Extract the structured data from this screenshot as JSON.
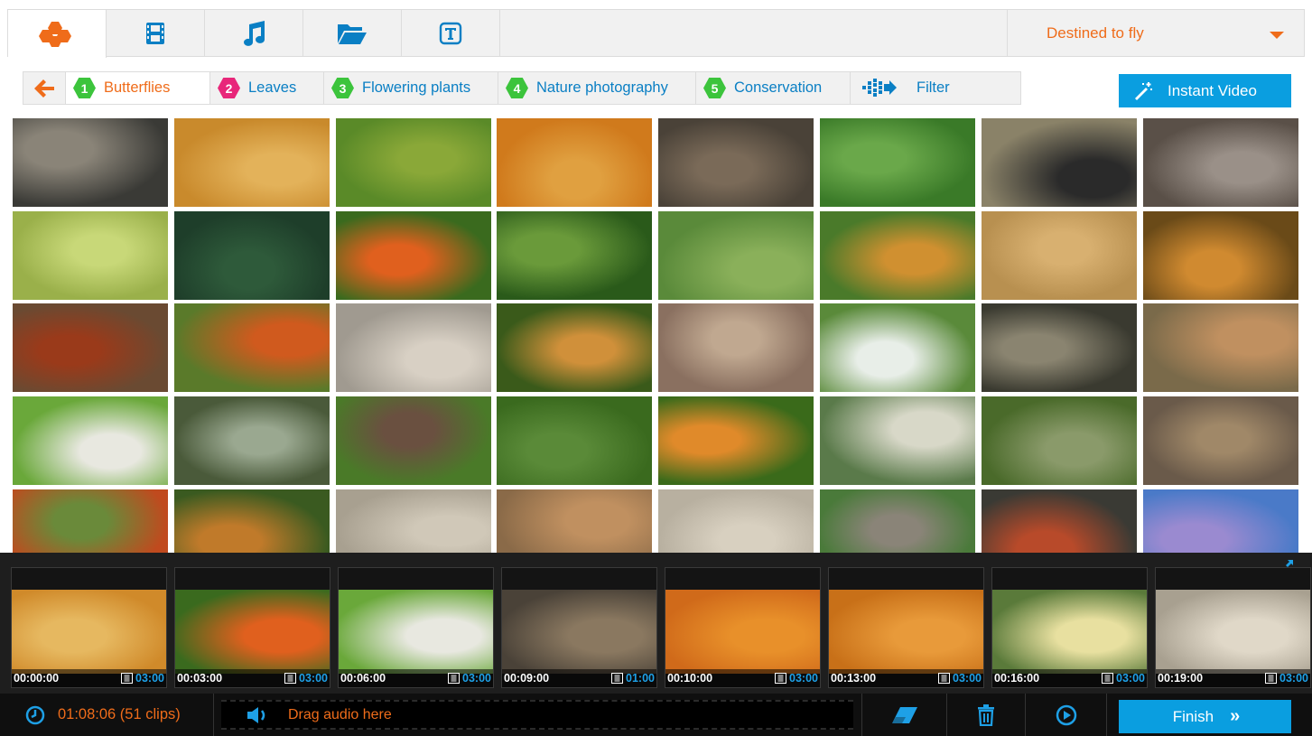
{
  "tabs": [
    {
      "name": "tab-effects",
      "icon": "hexagon-cluster-icon",
      "active": true
    },
    {
      "name": "tab-video",
      "icon": "film-icon",
      "active": false
    },
    {
      "name": "tab-music",
      "icon": "music-note-icon",
      "active": false
    },
    {
      "name": "tab-folder",
      "icon": "open-folder-icon",
      "active": false
    },
    {
      "name": "tab-text",
      "icon": "text-box-icon",
      "active": false
    }
  ],
  "project": {
    "selected": "Destined to fly"
  },
  "filterbar": {
    "back_icon": "arrow-left-icon",
    "categories": [
      {
        "number": "1",
        "label": "Butterflies",
        "color": "#3cc43c",
        "active": true
      },
      {
        "number": "2",
        "label": "Leaves",
        "color": "#e8277a",
        "active": false
      },
      {
        "number": "3",
        "label": "Flowering plants",
        "color": "#3cc43c",
        "active": false
      },
      {
        "number": "4",
        "label": "Nature photography",
        "color": "#3cc43c",
        "active": false
      },
      {
        "number": "5",
        "label": "Conservation",
        "color": "#3cc43c",
        "active": false
      }
    ],
    "filter_label": "Filter",
    "filter_icon": "dotted-arrow-icon"
  },
  "instant_video": {
    "label": "Instant Video",
    "icon": "magic-wand-icon"
  },
  "grid": {
    "rows": 5,
    "cols": 8,
    "thumbs": [
      [
        "#3a3a36",
        "#8a8478"
      ],
      [
        "#c98a2c",
        "#e3b25a"
      ],
      [
        "#5a8a28",
        "#8aa838"
      ],
      [
        "#d07a1c",
        "#e0a040"
      ],
      [
        "#4a4238",
        "#7a6a58"
      ],
      [
        "#3a7a28",
        "#6aa84a"
      ],
      [
        "#8a8268",
        "#2a2a2a"
      ],
      [
        "#5a5048",
        "#9a9088"
      ],
      [
        "#9ab04a",
        "#c8d878"
      ],
      [
        "#1e3e2a",
        "#2e5a3a"
      ],
      [
        "#3a6a1e",
        "#e0601e"
      ],
      [
        "#2a5a1a",
        "#6a9a3a"
      ],
      [
        "#5a8a3a",
        "#8ab05a"
      ],
      [
        "#4a7a2a",
        "#d09030"
      ],
      [
        "#b89050",
        "#d8b070"
      ],
      [
        "#6a4a18",
        "#d08a30"
      ],
      [
        "#6a4a32",
        "#9a3a1a"
      ],
      [
        "#5a7a2a",
        "#d05a1e"
      ],
      [
        "#a09a90",
        "#d8d0c4"
      ],
      [
        "#3a5a1a",
        "#d0903a"
      ],
      [
        "#8a7060",
        "#c0a890"
      ],
      [
        "#5a8a3a",
        "#e8eee8"
      ],
      [
        "#3a3a30",
        "#8a8470"
      ],
      [
        "#7a6a4a",
        "#c09060"
      ],
      [
        "#6aa83a",
        "#e8e8e0"
      ],
      [
        "#4a5a3a",
        "#9aa890"
      ],
      [
        "#4a7a28",
        "#6a5040"
      ],
      [
        "#3a6a1e",
        "#5a8a38"
      ],
      [
        "#3a6a1a",
        "#e08a2a"
      ],
      [
        "#5a7a4a",
        "#d8d8c8"
      ],
      [
        "#4a6a2a",
        "#8a9a6a"
      ],
      [
        "#6a5a4a",
        "#a08868"
      ],
      [
        "#c04a1e",
        "#6a8a3a"
      ],
      [
        "#3a5a20",
        "#c07a2a"
      ],
      [
        "#a8a090",
        "#d0c8b8"
      ],
      [
        "#8a6a48",
        "#c09060"
      ],
      [
        "#b8b0a0",
        "#d8d0c0"
      ],
      [
        "#4a7a3a",
        "#8a8478"
      ],
      [
        "#3a3a34",
        "#b84a2a"
      ],
      [
        "#4a7ac8",
        "#9a8ad0"
      ]
    ]
  },
  "timeline": {
    "expand_icon": "expand-arrows-icon",
    "clips": [
      {
        "start": "00:00:00",
        "duration": "03:00",
        "colors": [
          "#d08a2a",
          "#e6b860"
        ]
      },
      {
        "start": "00:03:00",
        "duration": "03:00",
        "colors": [
          "#3a6a1e",
          "#e0601e"
        ]
      },
      {
        "start": "00:06:00",
        "duration": "03:00",
        "colors": [
          "#6aa83a",
          "#e8e8e0"
        ]
      },
      {
        "start": "00:09:00",
        "duration": "01:00",
        "colors": [
          "#4a4238",
          "#8a7860"
        ]
      },
      {
        "start": "00:10:00",
        "duration": "03:00",
        "colors": [
          "#d06a1a",
          "#e8902a"
        ]
      },
      {
        "start": "00:13:00",
        "duration": "03:00",
        "colors": [
          "#c87018",
          "#e89a3a"
        ]
      },
      {
        "start": "00:16:00",
        "duration": "03:00",
        "colors": [
          "#5a7a3a",
          "#e8e0a0"
        ]
      },
      {
        "start": "00:19:00",
        "duration": "03:00",
        "colors": [
          "#a8a090",
          "#e0d8c8"
        ]
      }
    ]
  },
  "bottombar": {
    "clock_icon": "clock-icon",
    "total_time": "01:08:06 (51 clips)",
    "audio_icon": "speaker-icon",
    "audio_placeholder": "Drag audio here",
    "eraser_icon": "eraser-icon",
    "trash_icon": "trash-icon",
    "play_icon": "play-circle-icon",
    "finish_label": "Finish"
  }
}
